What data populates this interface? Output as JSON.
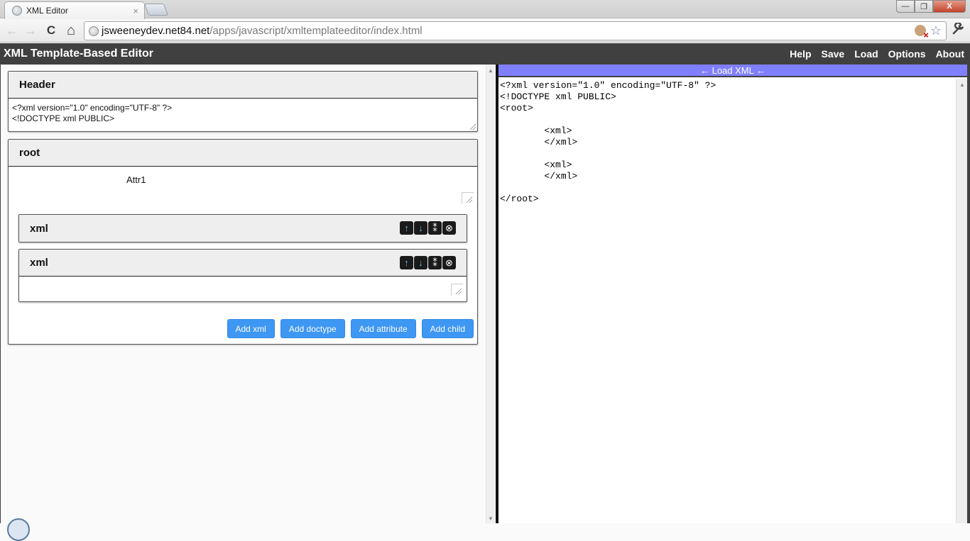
{
  "browser": {
    "tab_title": "XML Editor",
    "tab_close": "×",
    "url_host": "jsweeneydev.net84.net",
    "url_path": "/apps/javascript/xmltemplateeditor/index.html",
    "nav": {
      "back": "←",
      "forward": "→",
      "reload": "C",
      "home": "⌂"
    },
    "window": {
      "minimize": "—",
      "restore": "❐",
      "close": "X"
    },
    "star": "☆",
    "wrench": "🔧"
  },
  "app": {
    "title": "XML Template-Based Editor",
    "menu": [
      "Help",
      "Save",
      "Load",
      "Options",
      "About"
    ]
  },
  "editor": {
    "header_panel": {
      "title": "Header",
      "content": "<?xml version=\"1.0\" encoding=\"UTF-8\" ?>\n<!DOCTYPE xml PUBLIC>"
    },
    "root_panel": {
      "title": "root",
      "attribute_label": "Attr1",
      "children": [
        {
          "title": "xml",
          "controls": [
            "↑",
            "↓",
            "⁑",
            "⊗"
          ]
        },
        {
          "title": "xml",
          "controls": [
            "↑",
            "↓",
            "⁑",
            "⊗"
          ]
        }
      ],
      "buttons": [
        "Add xml",
        "Add doctype",
        "Add attribute",
        "Add child"
      ]
    }
  },
  "output": {
    "load_label": "← Load XML ←",
    "xml_text": "<?xml version=\"1.0\" encoding=\"UTF-8\" ?>\n<!DOCTYPE xml PUBLIC>\n<root>\n\n        <xml>\n        </xml>\n\n        <xml>\n        </xml>\n\n</root>"
  },
  "colors": {
    "app_header_bg": "#404040",
    "load_bar_bg": "#8080ff",
    "button_bg": "#3e97f3",
    "panel_head_bg": "#eeeeee"
  }
}
